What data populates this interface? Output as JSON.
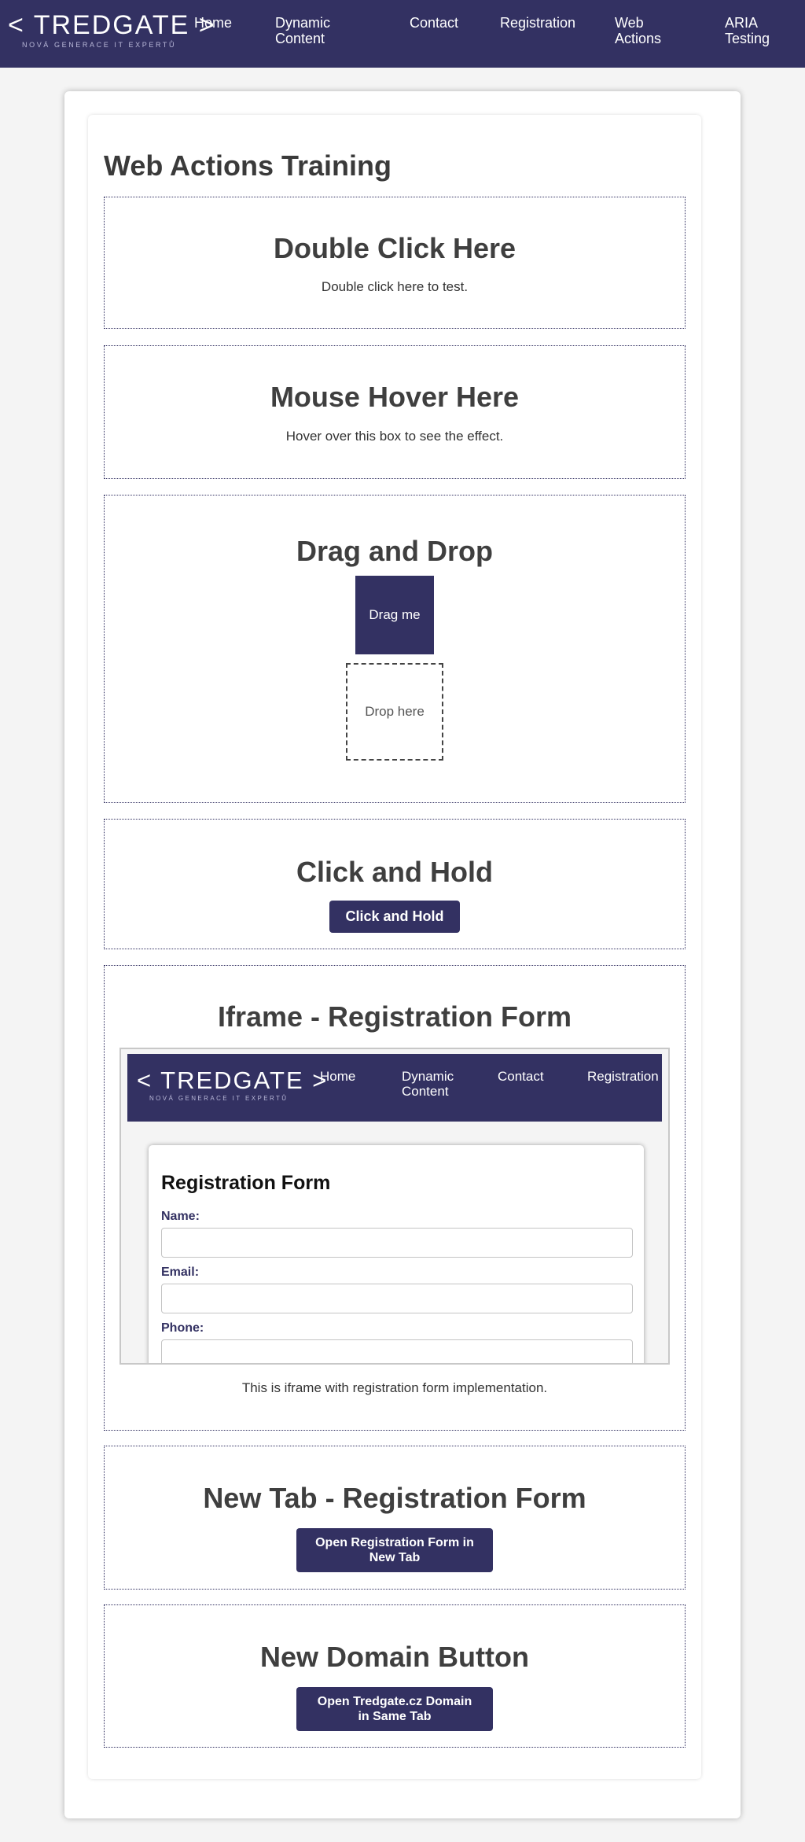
{
  "nav": {
    "logo_text": "< TREDGATE >",
    "logo_tagline": "NOVÁ GENERACE IT EXPERTŮ",
    "links": [
      "Home",
      "Dynamic Content",
      "Contact",
      "Registration",
      "Web Actions",
      "ARIA Testing"
    ]
  },
  "page": {
    "title": "Web Actions Training"
  },
  "double_click": {
    "heading": "Double Click Here",
    "text": "Double click here to test."
  },
  "hover": {
    "heading": "Mouse Hover Here",
    "text": "Hover over this box to see the effect."
  },
  "drag_drop": {
    "heading": "Drag and Drop",
    "drag_label": "Drag me",
    "drop_label": "Drop here"
  },
  "click_hold": {
    "heading": "Click and Hold",
    "button": "Click and Hold"
  },
  "iframe_section": {
    "heading": "Iframe - Registration Form",
    "caption": "This is iframe with registration form implementation.",
    "nav_links": [
      "Home",
      "Dynamic Content",
      "Contact",
      "Registration"
    ],
    "form_title": "Registration Form",
    "labels": [
      "Name:",
      "Email:",
      "Phone:"
    ]
  },
  "new_tab": {
    "heading": "New Tab - Registration Form",
    "button": "Open Registration Form in New Tab"
  },
  "new_domain": {
    "heading": "New Domain Button",
    "button": "Open Tredgate.cz Domain in Same Tab"
  },
  "colors": {
    "brand": "#333162",
    "page_bg": "#f4f4f4",
    "heading": "#3f3f3f"
  }
}
